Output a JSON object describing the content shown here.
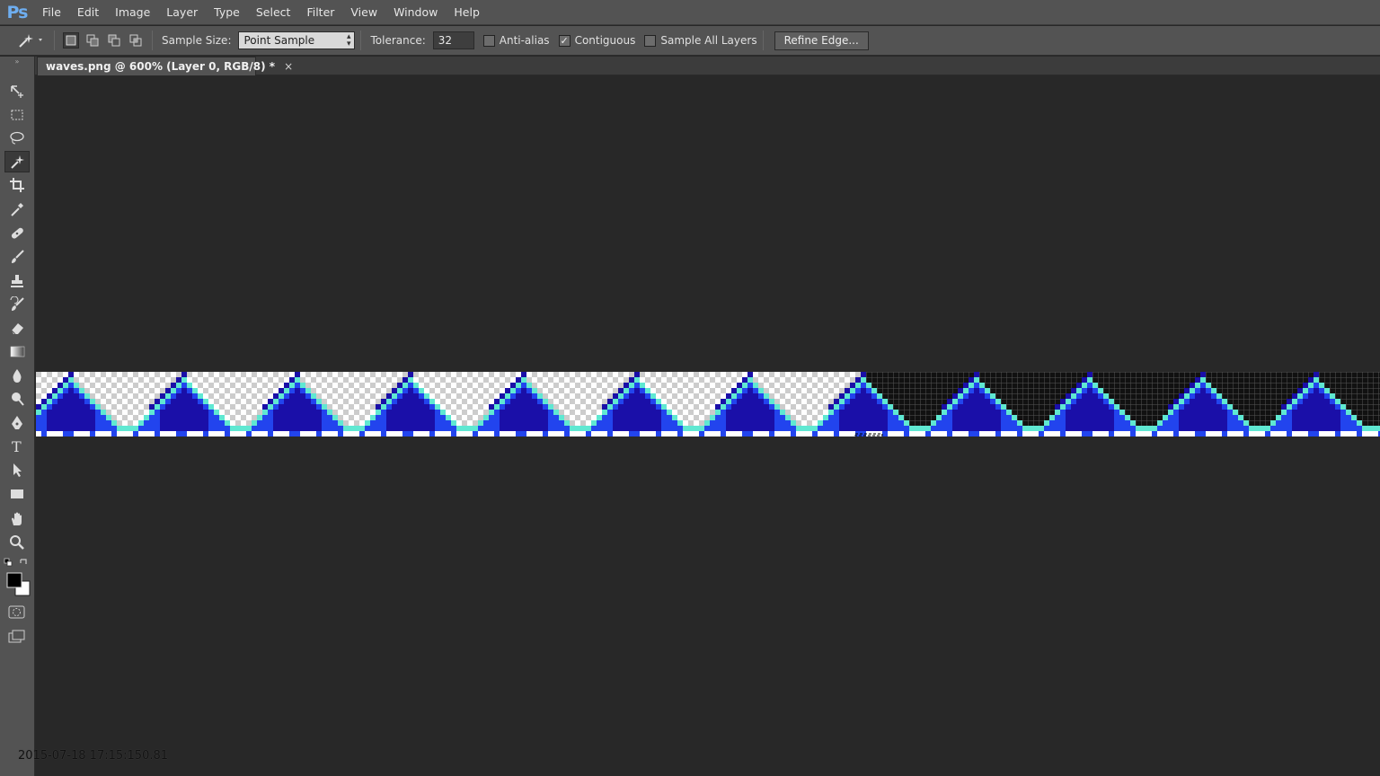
{
  "app": {
    "logo": "Ps",
    "menu": [
      "File",
      "Edit",
      "Image",
      "Layer",
      "Type",
      "Select",
      "Filter",
      "View",
      "Window",
      "Help"
    ]
  },
  "options": {
    "tool_icon": "magic-wand-icon",
    "selection_modes": [
      "new-selection",
      "add-to-selection",
      "subtract-from-selection",
      "intersect-with-selection"
    ],
    "sample_size_label": "Sample Size:",
    "sample_size_value": "Point Sample",
    "tolerance_label": "Tolerance:",
    "tolerance_value": "32",
    "anti_alias_label": "Anti-alias",
    "anti_alias_checked": false,
    "contiguous_label": "Contiguous",
    "contiguous_checked": true,
    "sample_all_layers_label": "Sample All Layers",
    "sample_all_layers_checked": false,
    "refine_edge_label": "Refine Edge..."
  },
  "document": {
    "tab_title": "waves.png @ 600% (Layer 0, RGB/8) *",
    "close_glyph": "×"
  },
  "tools": [
    "move-tool-icon",
    "rectangular-marquee-icon",
    "lasso-icon",
    "magic-wand-icon",
    "crop-icon",
    "eyedropper-icon",
    "healing-brush-icon",
    "brush-icon",
    "clone-stamp-icon",
    "history-brush-icon",
    "eraser-icon",
    "gradient-icon",
    "blur-icon",
    "dodge-icon",
    "pen-icon",
    "type-icon",
    "path-selection-icon",
    "rectangle-shape-icon",
    "hand-icon",
    "zoom-icon"
  ],
  "colors": {
    "foreground": "#000000",
    "background": "#ffffff",
    "wave_dark": "#1a0fa8",
    "wave_mid": "#2244ee",
    "wave_light": "#5fe8d2",
    "wave_white": "#ffffff"
  },
  "timestamp": "2015-07-18 17:15:150.81"
}
